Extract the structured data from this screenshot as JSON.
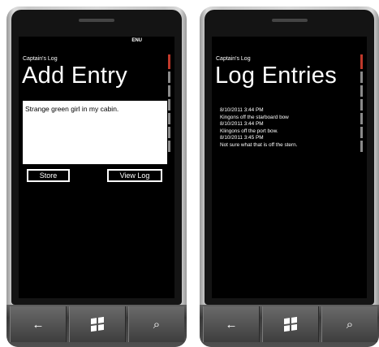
{
  "add_screen": {
    "status_text": "ENU",
    "app_title": "Captain's Log",
    "page_title": "Add Entry",
    "entry_text": "Strange green girl in my cabin.",
    "store_label": "Store",
    "viewlog_label": "View Log"
  },
  "log_screen": {
    "app_title": "Captain's Log",
    "page_title": "Log Entries",
    "entries": [
      "8/10/2011 3:44 PM",
      "Kingons off the starboard bow",
      "8/10/2011 3:44 PM",
      "Klingons off the port bow.",
      "8/10/2011 3:45 PM",
      "Not sure what that is off the stern."
    ]
  },
  "hardware_buttons": {
    "icons": [
      "back-arrow-icon",
      "windows-logo-icon",
      "search-icon"
    ],
    "back_glyph": "←",
    "search_glyph": "⌕"
  }
}
